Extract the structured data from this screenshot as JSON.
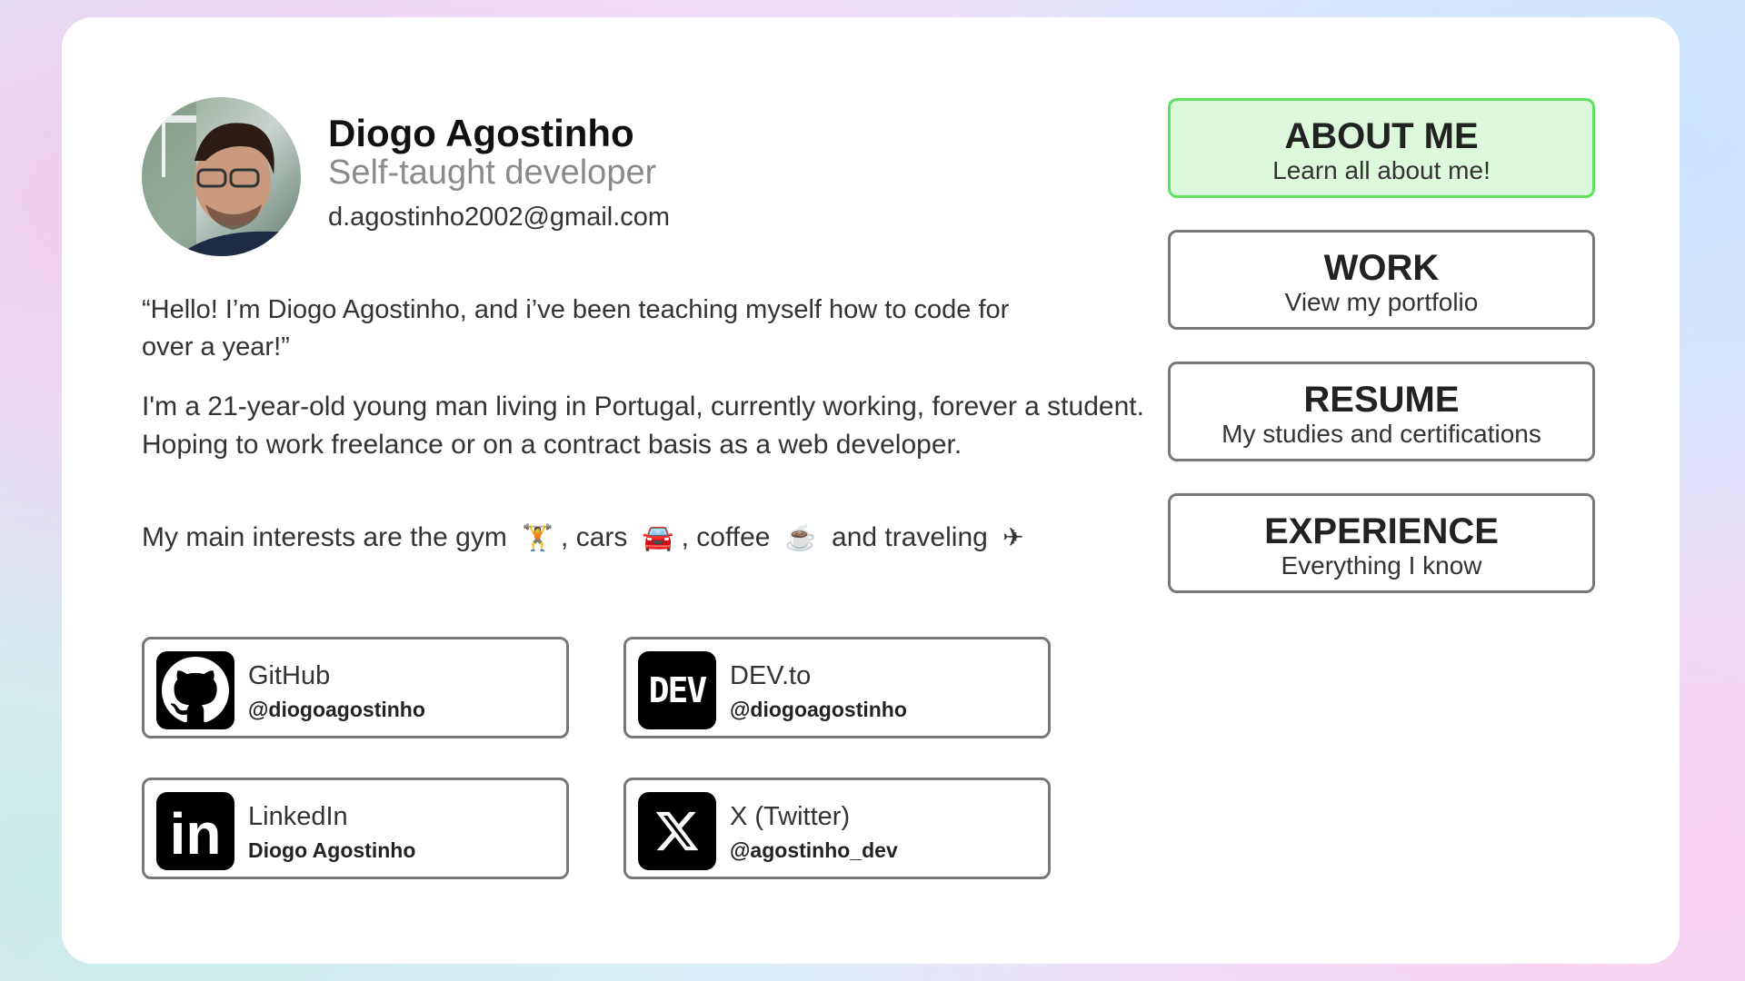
{
  "profile": {
    "name": "Diogo Agostinho",
    "subtitle": "Self-taught developer",
    "email": "d.agostinho2002@gmail.com"
  },
  "about": {
    "quote": "“Hello! I’m Diogo Agostinho, and i’ve been teaching myself how to code for over a year!”",
    "bio": "I'm a 21-year-old young man living in Portugal, currently working, forever a student. Hoping to work freelance or on a contract basis as a web developer.",
    "interests": {
      "prefix": "My main interests are the gym",
      "gym_emoji": "🏋",
      "cars_text": ", cars",
      "car_emoji": "🚘",
      "coffee_text": ", coffee",
      "coffee_emoji": "☕",
      "travel_text": "and traveling",
      "plane_emoji": "✈"
    }
  },
  "socials": [
    {
      "platform": "GitHub",
      "handle": "@diogoagostinho",
      "icon": "github-icon"
    },
    {
      "platform": "DEV.to",
      "handle": "@diogoagostinho",
      "icon": "dev-icon",
      "logo_text": "DEV"
    },
    {
      "platform": "LinkedIn",
      "handle": "Diogo Agostinho",
      "icon": "linkedin-icon",
      "logo_text": "in"
    },
    {
      "platform": "X (Twitter)",
      "handle": "@agostinho_dev",
      "icon": "x-icon"
    }
  ],
  "nav": [
    {
      "title": "ABOUT ME",
      "desc": "Learn all about me!",
      "active": true
    },
    {
      "title": "WORK",
      "desc": "View my portfolio",
      "active": false
    },
    {
      "title": "RESUME",
      "desc": "My studies and certifications",
      "active": false
    },
    {
      "title": "EXPERIENCE",
      "desc": "Everything I know",
      "active": false
    }
  ],
  "colors": {
    "active_bg": "#dcf9dc",
    "active_border": "#5fe05f",
    "border": "#777777"
  }
}
